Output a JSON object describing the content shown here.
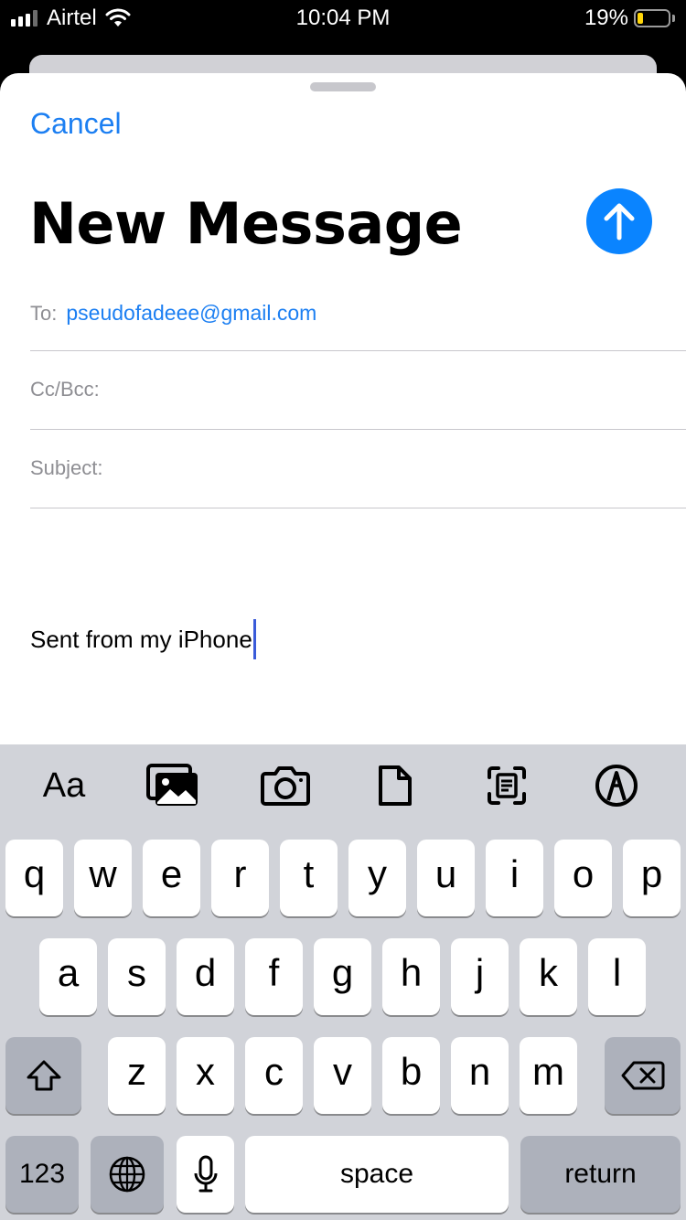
{
  "status_bar": {
    "carrier": "Airtel",
    "time": "10:04 PM",
    "battery_percent": "19%",
    "battery_level": 0.19,
    "battery_color": "#ffd60a",
    "icons": [
      "signal-icon",
      "wifi-icon",
      "battery-icon"
    ]
  },
  "compose": {
    "cancel_label": "Cancel",
    "title": "New Message",
    "send_icon": "arrow-up-icon",
    "to_label": "To:",
    "to_value": "pseudofadeee@gmail.com",
    "cc_label": "Cc/Bcc:",
    "subject_label": "Subject:",
    "body": "Sent from my iPhone"
  },
  "toolbar": {
    "format_label": "Aa",
    "icons": [
      "photo-library-icon",
      "camera-icon",
      "document-icon",
      "scan-document-icon",
      "markup-icon"
    ]
  },
  "keyboard": {
    "row1": [
      "q",
      "w",
      "e",
      "r",
      "t",
      "y",
      "u",
      "i",
      "o",
      "p"
    ],
    "row2": [
      "a",
      "s",
      "d",
      "f",
      "g",
      "h",
      "j",
      "k",
      "l"
    ],
    "row3": [
      "z",
      "x",
      "c",
      "v",
      "b",
      "n",
      "m"
    ],
    "numbers_label": "123",
    "space_label": "space",
    "return_label": "return",
    "icons": [
      "shift-icon",
      "delete-icon",
      "globe-icon",
      "microphone-icon"
    ]
  },
  "colors": {
    "accent": "#1c7ff2",
    "send_button": "#0a84ff",
    "caret": "#3a5bd9",
    "keyboard_bg": "#d1d3d9",
    "dark_key": "#adb1bb"
  }
}
